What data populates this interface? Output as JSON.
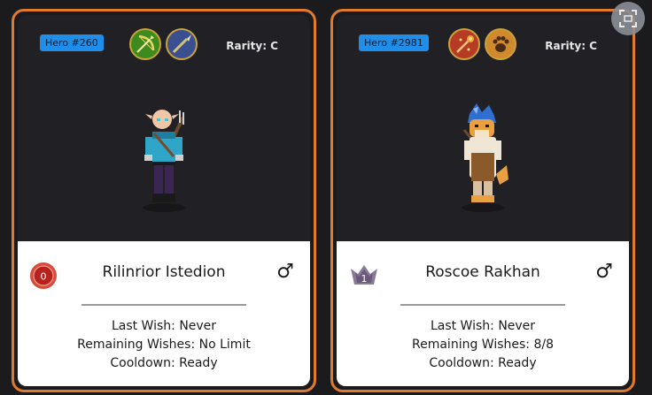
{
  "cards": [
    {
      "hero_id": "Hero #260",
      "rarity": "Rarity: C",
      "class_icons": [
        "bow-icon",
        "spear-icon"
      ],
      "rank": "0",
      "name": "Rilinrior Istedion",
      "gender_symbol": "♂",
      "last_wish_label": "Last Wish:",
      "last_wish": "Never",
      "remaining_label": "Remaining Wishes:",
      "remaining": "No Limit",
      "cooldown_label": "Cooldown:",
      "cooldown": "Ready"
    },
    {
      "hero_id": "Hero #2981",
      "rarity": "Rarity: C",
      "class_icons": [
        "fire-staff-icon",
        "paw-icon"
      ],
      "rank": "1",
      "name": "Roscoe Rakhan",
      "gender_symbol": "♂",
      "last_wish_label": "Last Wish:",
      "last_wish": "Never",
      "remaining_label": "Remaining Wishes:",
      "remaining": "8/8",
      "cooldown_label": "Cooldown:",
      "cooldown": "Ready"
    }
  ],
  "colors": {
    "card_border": "#e07a2c",
    "card_top_bg": "#212125",
    "hero_badge": "#1e8ee8"
  }
}
